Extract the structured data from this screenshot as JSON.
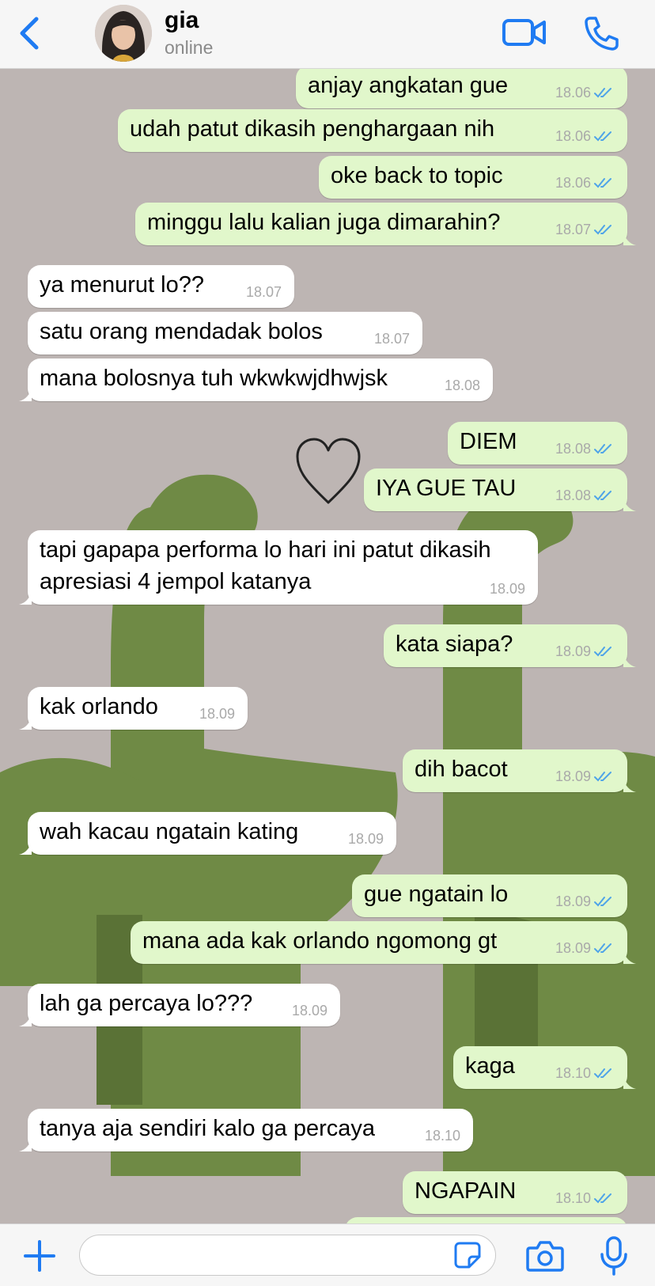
{
  "header": {
    "back_icon": "chevron-left-icon",
    "contact_name": "gia",
    "contact_status": "online",
    "video_icon": "video-camera-icon",
    "call_icon": "phone-icon",
    "accent_color": "#1f7bf2"
  },
  "messages": [
    {
      "dir": "out",
      "text": "anjay angkatan gue",
      "time": "18.06"
    },
    {
      "dir": "out",
      "text": "udah patut dikasih penghargaan nih",
      "time": "18.06"
    },
    {
      "dir": "out",
      "text": "oke back to topic",
      "time": "18.06"
    },
    {
      "dir": "out",
      "text": "minggu lalu kalian juga dimarahin?",
      "time": "18.07"
    },
    {
      "dir": "in",
      "text": "ya menurut lo??",
      "time": "18.07"
    },
    {
      "dir": "in",
      "text": "satu orang mendadak bolos",
      "time": "18.07"
    },
    {
      "dir": "in",
      "text": "mana bolosnya tuh wkwkwjdhwjsk",
      "time": "18.08"
    },
    {
      "dir": "out",
      "text": "DIEM",
      "time": "18.08"
    },
    {
      "dir": "out",
      "text": "IYA GUE TAU",
      "time": "18.08"
    },
    {
      "dir": "in",
      "text": "tapi gapapa performa lo hari ini patut dikasih apresiasi 4 jempol katanya",
      "time": "18.09"
    },
    {
      "dir": "out",
      "text": "kata siapa?",
      "time": "18.09"
    },
    {
      "dir": "in",
      "text": "kak orlando",
      "time": "18.09"
    },
    {
      "dir": "out",
      "text": "dih bacot",
      "time": "18.09"
    },
    {
      "dir": "in",
      "text": "wah kacau ngatain kating",
      "time": "18.09"
    },
    {
      "dir": "out",
      "text": "gue ngatain lo",
      "time": "18.09"
    },
    {
      "dir": "out",
      "text": "mana ada kak orlando ngomong gt",
      "time": "18.09"
    },
    {
      "dir": "in",
      "text": "lah ga percaya lo???",
      "time": "18.09"
    },
    {
      "dir": "out",
      "text": "kaga",
      "time": "18.10"
    },
    {
      "dir": "in",
      "text": "tanya aja sendiri kalo ga percaya",
      "time": "18.10"
    },
    {
      "dir": "out",
      "text": "NGAPAIN",
      "time": "18.10"
    }
  ],
  "decor": {
    "heart_icon": "heart-doodle-icon",
    "wallpaper": "dinosaur-wallpaper"
  },
  "composer": {
    "plus_icon": "plus-icon",
    "sticker_icon": "sticker-icon",
    "camera_icon": "camera-icon",
    "mic_icon": "microphone-icon",
    "input_value": ""
  },
  "colors": {
    "outgoing_bubble": "#e1f7cb",
    "incoming_bubble": "#ffffff",
    "read_ticks": "#4fa4e8",
    "wallpaper_bg": "#bdb5b3",
    "dino_green": "#6f8a45"
  }
}
